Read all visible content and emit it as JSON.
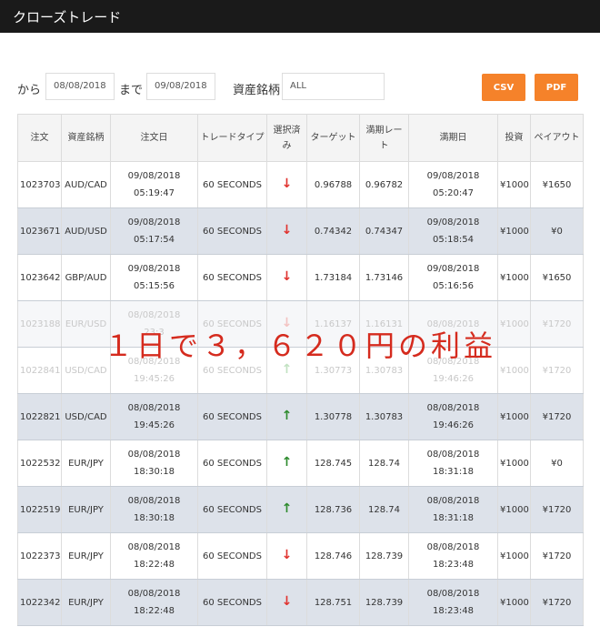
{
  "header": {
    "title": "クローズトレード"
  },
  "filters": {
    "from_label": "から",
    "from_value": "08/08/2018",
    "to_label": "まで",
    "to_value": "09/08/2018",
    "asset_label": "資産銘柄",
    "asset_value": "ALL",
    "csv_label": "CSV",
    "pdf_label": "PDF"
  },
  "table": {
    "columns": {
      "order": "注文",
      "asset": "資産銘柄",
      "order_date": "注文日",
      "trade_type": "トレードタイプ",
      "selected": "選択済み",
      "target": "ターゲット",
      "expiry_rate": "満期レート",
      "expiry_date": "満期日",
      "investment": "投資",
      "payout": "ペイアウト"
    },
    "rows": [
      {
        "order": "1023703",
        "asset": "AUD/CAD",
        "order_date": "09/08/2018",
        "order_time": "05:19:47",
        "type": "60 SECONDS",
        "dir": "down",
        "target": "0.96788",
        "rate": "0.96782",
        "exp_date": "09/08/2018",
        "exp_time": "05:20:47",
        "invest": "¥1000",
        "payout": "¥1650"
      },
      {
        "order": "1023671",
        "asset": "AUD/USD",
        "order_date": "09/08/2018",
        "order_time": "05:17:54",
        "type": "60 SECONDS",
        "dir": "down",
        "target": "0.74342",
        "rate": "0.74347",
        "exp_date": "09/08/2018",
        "exp_time": "05:18:54",
        "invest": "¥1000",
        "payout": "¥0"
      },
      {
        "order": "1023642",
        "asset": "GBP/AUD",
        "order_date": "09/08/2018",
        "order_time": "05:15:56",
        "type": "60 SECONDS",
        "dir": "down",
        "target": "1.73184",
        "rate": "1.73146",
        "exp_date": "09/08/2018",
        "exp_time": "05:16:56",
        "invest": "¥1000",
        "payout": "¥1650"
      },
      {
        "order": "1023188",
        "asset": "EUR/USD",
        "order_date": "08/08/2018",
        "order_time": "23:3",
        "type": "60 SECONDS",
        "dir": "down",
        "target": "1.16137",
        "rate": "1.16131",
        "exp_date": "08/08/2018",
        "exp_time": "",
        "invest": "¥1000",
        "payout": "¥1720"
      },
      {
        "order": "1022841",
        "asset": "USD/CAD",
        "order_date": "08/08/2018",
        "order_time": "19:45:26",
        "type": "60 SECONDS",
        "dir": "up",
        "target": "1.30773",
        "rate": "1.30783",
        "exp_date": "08/08/2018",
        "exp_time": "19:46:26",
        "invest": "¥1000",
        "payout": "¥1720"
      },
      {
        "order": "1022821",
        "asset": "USD/CAD",
        "order_date": "08/08/2018",
        "order_time": "19:45:26",
        "type": "60 SECONDS",
        "dir": "up",
        "target": "1.30778",
        "rate": "1.30783",
        "exp_date": "08/08/2018",
        "exp_time": "19:46:26",
        "invest": "¥1000",
        "payout": "¥1720"
      },
      {
        "order": "1022532",
        "asset": "EUR/JPY",
        "order_date": "08/08/2018",
        "order_time": "18:30:18",
        "type": "60 SECONDS",
        "dir": "up",
        "target": "128.745",
        "rate": "128.74",
        "exp_date": "08/08/2018",
        "exp_time": "18:31:18",
        "invest": "¥1000",
        "payout": "¥0"
      },
      {
        "order": "1022519",
        "asset": "EUR/JPY",
        "order_date": "08/08/2018",
        "order_time": "18:30:18",
        "type": "60 SECONDS",
        "dir": "up",
        "target": "128.736",
        "rate": "128.74",
        "exp_date": "08/08/2018",
        "exp_time": "18:31:18",
        "invest": "¥1000",
        "payout": "¥1720"
      },
      {
        "order": "1022373",
        "asset": "EUR/JPY",
        "order_date": "08/08/2018",
        "order_time": "18:22:48",
        "type": "60 SECONDS",
        "dir": "down",
        "target": "128.746",
        "rate": "128.739",
        "exp_date": "08/08/2018",
        "exp_time": "18:23:48",
        "invest": "¥1000",
        "payout": "¥1720"
      },
      {
        "order": "1022342",
        "asset": "EUR/JPY",
        "order_date": "08/08/2018",
        "order_time": "18:22:48",
        "type": "60 SECONDS",
        "dir": "down",
        "target": "128.751",
        "rate": "128.739",
        "exp_date": "08/08/2018",
        "exp_time": "18:23:48",
        "invest": "¥1000",
        "payout": "¥1720"
      }
    ]
  },
  "overlay": {
    "text": "１日で３，６２０円の利益"
  },
  "colors": {
    "accent": "#f5822a",
    "topbar": "#1a1a1a",
    "down": "#e0322e",
    "up": "#2e8b2e",
    "overlay": "#d52b1e"
  },
  "icons": {
    "down": "arrow-down-icon",
    "up": "arrow-up-icon"
  }
}
